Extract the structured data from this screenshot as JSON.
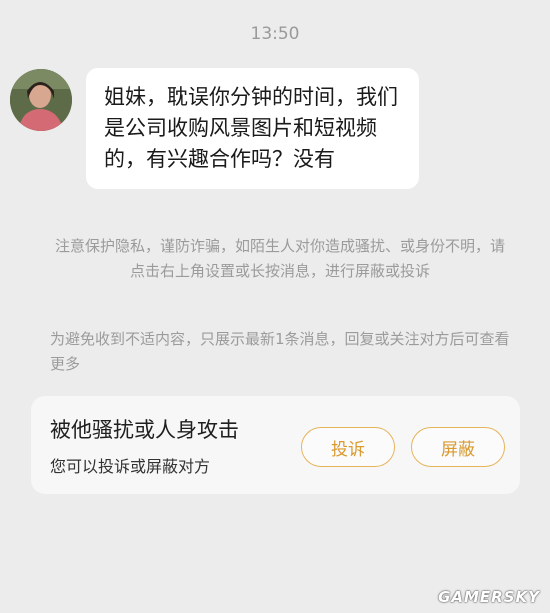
{
  "timestamp": "13:50",
  "message": {
    "text": "姐妹，耽误你分钟的时间，我们是公司收购风景图片和短视频的，有兴趣合作吗？没有"
  },
  "notices": {
    "privacy": "注意保护隐私，谨防诈骗，如陌生人对你造成骚扰、或身份不明，请点击右上角设置或长按消息，进行屏蔽或投诉",
    "limit": "为避免收到不适内容，只展示最新1条消息，回复或关注对方后可查看更多"
  },
  "harassment_card": {
    "title": "被他骚扰或人身攻击",
    "subtitle": "您可以投诉或屏蔽对方",
    "report_label": "投诉",
    "block_label": "屏蔽"
  },
  "watermark": "GAMERSKY",
  "colors": {
    "background": "#ececec",
    "bubble": "#ffffff",
    "accent": "#d99a30",
    "muted_text": "#9b9b9b"
  }
}
